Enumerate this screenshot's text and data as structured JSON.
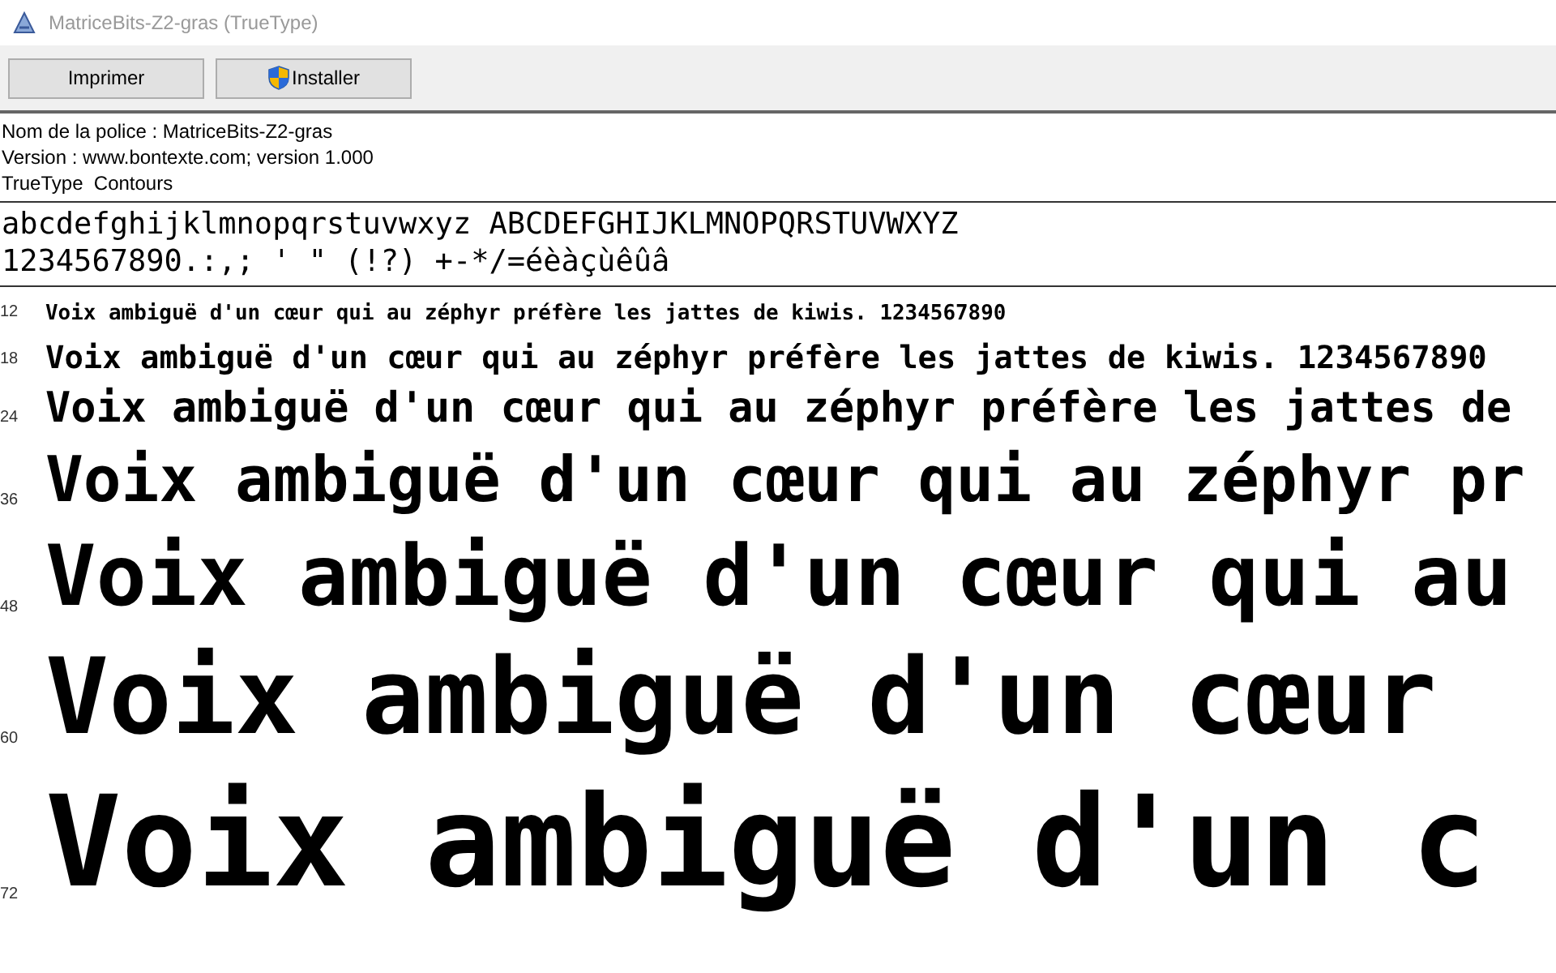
{
  "window": {
    "title": "MatriceBits-Z2-gras (TrueType)"
  },
  "toolbar": [
    {
      "label": "Imprimer",
      "kind": "plain"
    },
    {
      "label": "Installer",
      "kind": "shield"
    }
  ],
  "info": [
    "Nom de la police : MatriceBits-Z2-gras",
    "Version : www.bontexte.com; version 1.000",
    "TrueType  Contours"
  ],
  "charset": [
    "abcdefghijklmnopqrstuvwxyz ABCDEFGHIJKLMNOPQRSTUVWXYZ",
    "1234567890.:,; ' \" (!?) +-*/=éèàçùêûâ"
  ],
  "samples": [
    {
      "size": "12",
      "text": "Voix ambiguë d'un cœur qui au zéphyr préfère les jattes de kiwis. 1234567890"
    },
    {
      "size": "18",
      "text": "Voix ambiguë d'un cœur qui au zéphyr préfère les jattes de kiwis. 1234567890"
    },
    {
      "size": "24",
      "text": "Voix ambiguë d'un cœur qui au zéphyr préfère les jattes de"
    },
    {
      "size": "36",
      "text": "Voix ambiguë d'un cœur qui au zéphyr pr"
    },
    {
      "size": "48",
      "text": "Voix ambiguë d'un cœur qui au"
    },
    {
      "size": "60",
      "text": "Voix ambiguë d'un cœur"
    },
    {
      "size": "72",
      "text": "Voix ambiguë d'un c"
    }
  ]
}
